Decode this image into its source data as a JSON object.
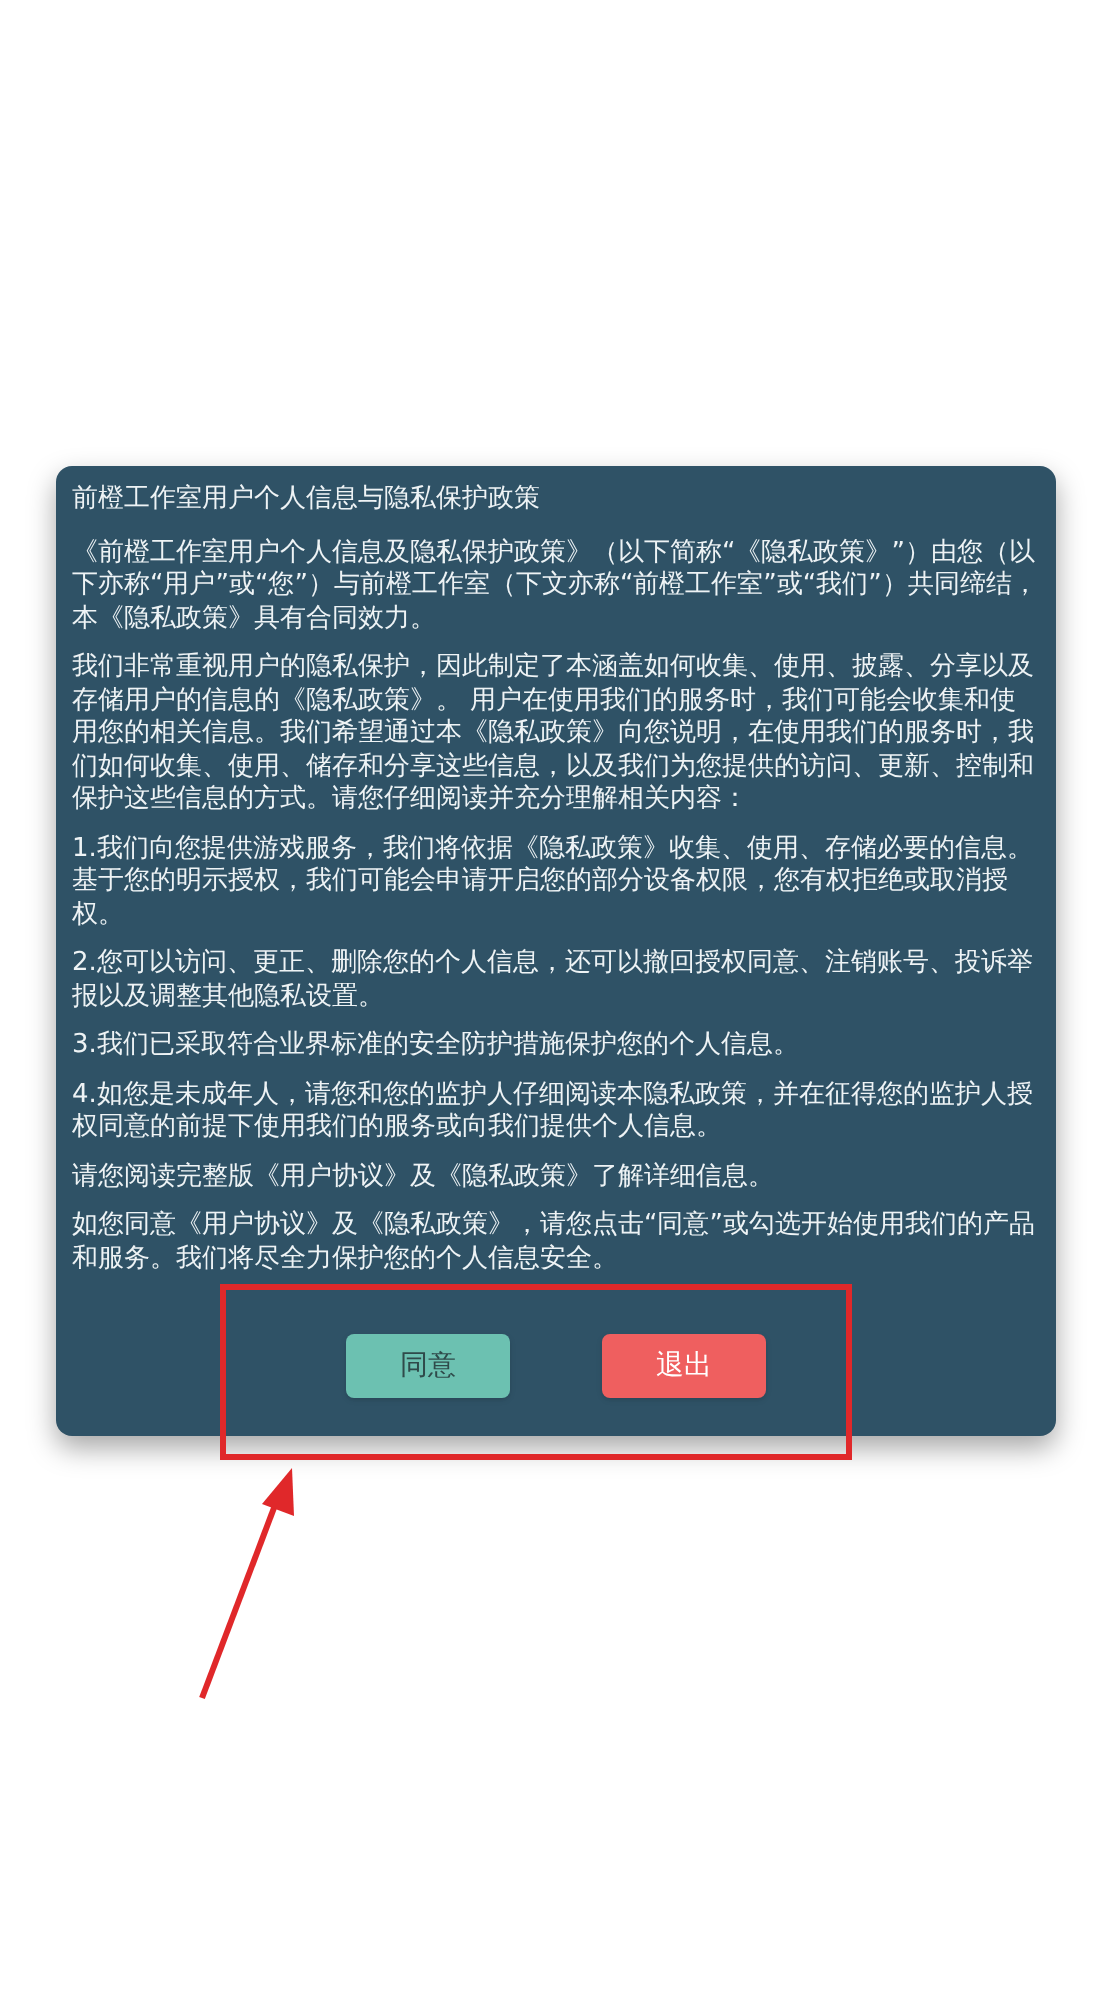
{
  "dialog": {
    "title": "前橙工作室用户个人信息与隐私保护政策",
    "paragraphs": [
      "《前橙工作室用户个人信息及隐私保护政策》（以下简称“《隐私政策》”）由您（以下亦称“用户”或“您”）与前橙工作室（下文亦称“前橙工作室”或“我们”）共同缔结，本《隐私政策》具有合同效力。",
      "我们非常重视用户的隐私保护，因此制定了本涵盖如何收集、使用、披露、分享以及存储用户的信息的《隐私政策》。 用户在使用我们的服务时，我们可能会收集和使用您的相关信息。我们希望通过本《隐私政策》向您说明，在使用我们的服务时，我们如何收集、使用、储存和分享这些信息，以及我们为您提供的访问、更新、控制和保护这些信息的方式。请您仔细阅读并充分理解相关内容：",
      "1.我们向您提供游戏服务，我们将依据《隐私政策》收集、使用、存储必要的信息。基于您的明示授权，我们可能会申请开启您的部分设备权限，您有权拒绝或取消授权。",
      "2.您可以访问、更正、删除您的个人信息，还可以撤回授权同意、注销账号、投诉举报以及调整其他隐私设置。",
      "3.我们已采取符合业界标准的安全防护措施保护您的个人信息。",
      "4.如您是未成年人，请您和您的监护人仔细阅读本隐私政策，并在征得您的监护人授权同意的前提下使用我们的服务或向我们提供个人信息。",
      "请您阅读完整版《用户协议》及《隐私政策》了解详细信息。",
      "如您同意《用户协议》及《隐私政策》，请您点击“同意”或勾选开始使用我们的产品和服务。我们将尽全力保护您的个人信息安全。"
    ],
    "buttons": [
      {
        "label": "同意",
        "kind": "agree"
      },
      {
        "label": "退出",
        "kind": "exit"
      }
    ]
  }
}
